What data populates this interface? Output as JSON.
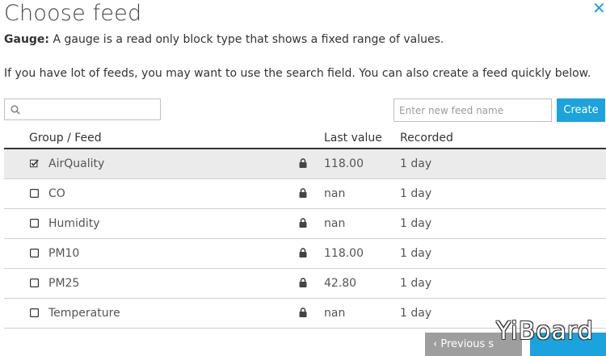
{
  "dialog": {
    "title": "Choose feed",
    "description_label": "Gauge:",
    "description_text": " A gauge is a read only block type that shows a fixed range of values.",
    "info": "If you have lot of feeds, you may want to use the search field. You can also create a feed quickly below."
  },
  "search": {
    "value": "",
    "placeholder": ""
  },
  "new_feed": {
    "placeholder": "Enter new feed name",
    "create_label": "Create"
  },
  "table": {
    "headers": {
      "feed": "Group / Feed",
      "last_value": "Last value",
      "recorded": "Recorded"
    },
    "rows": [
      {
        "name": "AirQuality",
        "last_value": "118.00",
        "recorded": "1 day",
        "checked": true
      },
      {
        "name": "CO",
        "last_value": "nan",
        "recorded": "1 day",
        "checked": false
      },
      {
        "name": "Humidity",
        "last_value": "nan",
        "recorded": "1 day",
        "checked": false
      },
      {
        "name": "PM10",
        "last_value": "118.00",
        "recorded": "1 day",
        "checked": false
      },
      {
        "name": "PM25",
        "last_value": "42.80",
        "recorded": "1 day",
        "checked": false
      },
      {
        "name": "Temperature",
        "last_value": "nan",
        "recorded": "1 day",
        "checked": false
      }
    ]
  },
  "footer": {
    "previous_label": "‹ Previous s",
    "watermark": "YiBoard"
  },
  "colors": {
    "accent": "#1aa3dc",
    "selected_row": "#ebebeb",
    "secondary_button": "#9e9e9e"
  }
}
